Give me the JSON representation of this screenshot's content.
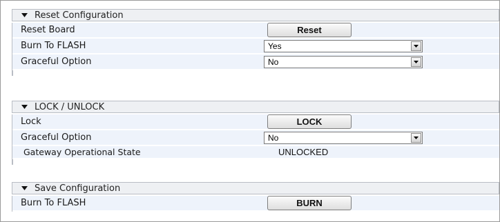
{
  "sections": {
    "reset": {
      "title": "Reset Configuration",
      "rows": {
        "reset_board": {
          "label": "Reset Board",
          "button": "Reset"
        },
        "burn_to_flash": {
          "label": "Burn To FLASH",
          "value": "Yes"
        },
        "graceful_option": {
          "label": "Graceful Option",
          "value": "No"
        }
      }
    },
    "lock": {
      "title": "LOCK / UNLOCK",
      "rows": {
        "lock": {
          "label": "Lock",
          "button": "LOCK"
        },
        "graceful_option": {
          "label": "Graceful Option",
          "value": "No"
        },
        "gateway_state": {
          "label": "Gateway Operational State",
          "value": "UNLOCKED"
        }
      }
    },
    "save": {
      "title": "Save Configuration",
      "rows": {
        "burn_to_flash": {
          "label": "Burn To FLASH",
          "button": "BURN"
        }
      }
    }
  },
  "icons": {
    "collapse": "collapse-triangle-icon",
    "dropdown": "dropdown-arrow-icon"
  },
  "colors": {
    "header_bg": "#eef0f3",
    "row_bg": "#eef3fb",
    "border": "#b9bdc4"
  }
}
